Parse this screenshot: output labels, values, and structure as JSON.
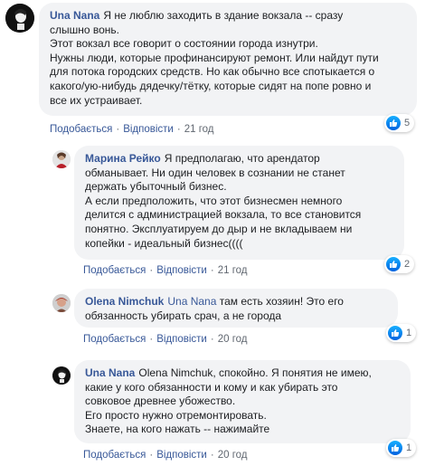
{
  "comments": [
    {
      "author": "Una Nana",
      "lines": [
        "Я не люблю заходить в здание вокзала -- сразу",
        "слышно вонь.",
        "Этот вокзал все говорит о состоянии города изнутри.",
        "Нужны люди, которые профинансируют ремонт. Или найдут пути",
        "для потока городских средств. Но как обычно все спотыкается о",
        "какого/ую-нибудь дядечку/тётку, которые сидят на попе ровно и",
        "все их устраивает."
      ],
      "like_label": "Подобається",
      "reply_label": "Відповісти",
      "time": "21 год",
      "reactions": "5"
    },
    {
      "author": "Марина Рейко",
      "lines": [
        "Я предполагаю, что арендатор",
        "обманывает. Ни один человек в сознании не станет",
        "держать убыточный бизнес.",
        "А если предположить, что этот бизнесмен немного",
        "делится с администрацией вокзала, то все становится",
        "понятно. Эксплуатируем до дыр и не вкладываем ни",
        "копейки - идеальный бизнес(((("
      ],
      "like_label": "Подобається",
      "reply_label": "Відповісти",
      "time": "21 год",
      "reactions": "2"
    },
    {
      "author": "Olena Nimchuk",
      "mention": "Una Nana",
      "lines": [
        "там есть хозяин! Это его",
        "обязанность убирать срач, а не города"
      ],
      "like_label": "Подобається",
      "reply_label": "Відповісти",
      "time": "20 год",
      "reactions": "1"
    },
    {
      "author": "Una Nana",
      "lines": [
        "Olena Nimchuk, спокойно. Я понятия не имею,",
        "какие у кого обязанности и кому и как убирать это",
        "совковое древнее убожество.",
        "Его просто нужно отремонтировать.",
        "Знаете, на кого нажать -- нажимайте"
      ],
      "like_label": "Подобається",
      "reply_label": "Відповісти",
      "time": "20 год",
      "reactions": "1"
    }
  ],
  "colors": {
    "link": "#385898",
    "bubble": "#f2f3f5",
    "meta": "#606770",
    "like": "#1877f2"
  },
  "icons": {
    "like": "thumbs-up-icon"
  }
}
